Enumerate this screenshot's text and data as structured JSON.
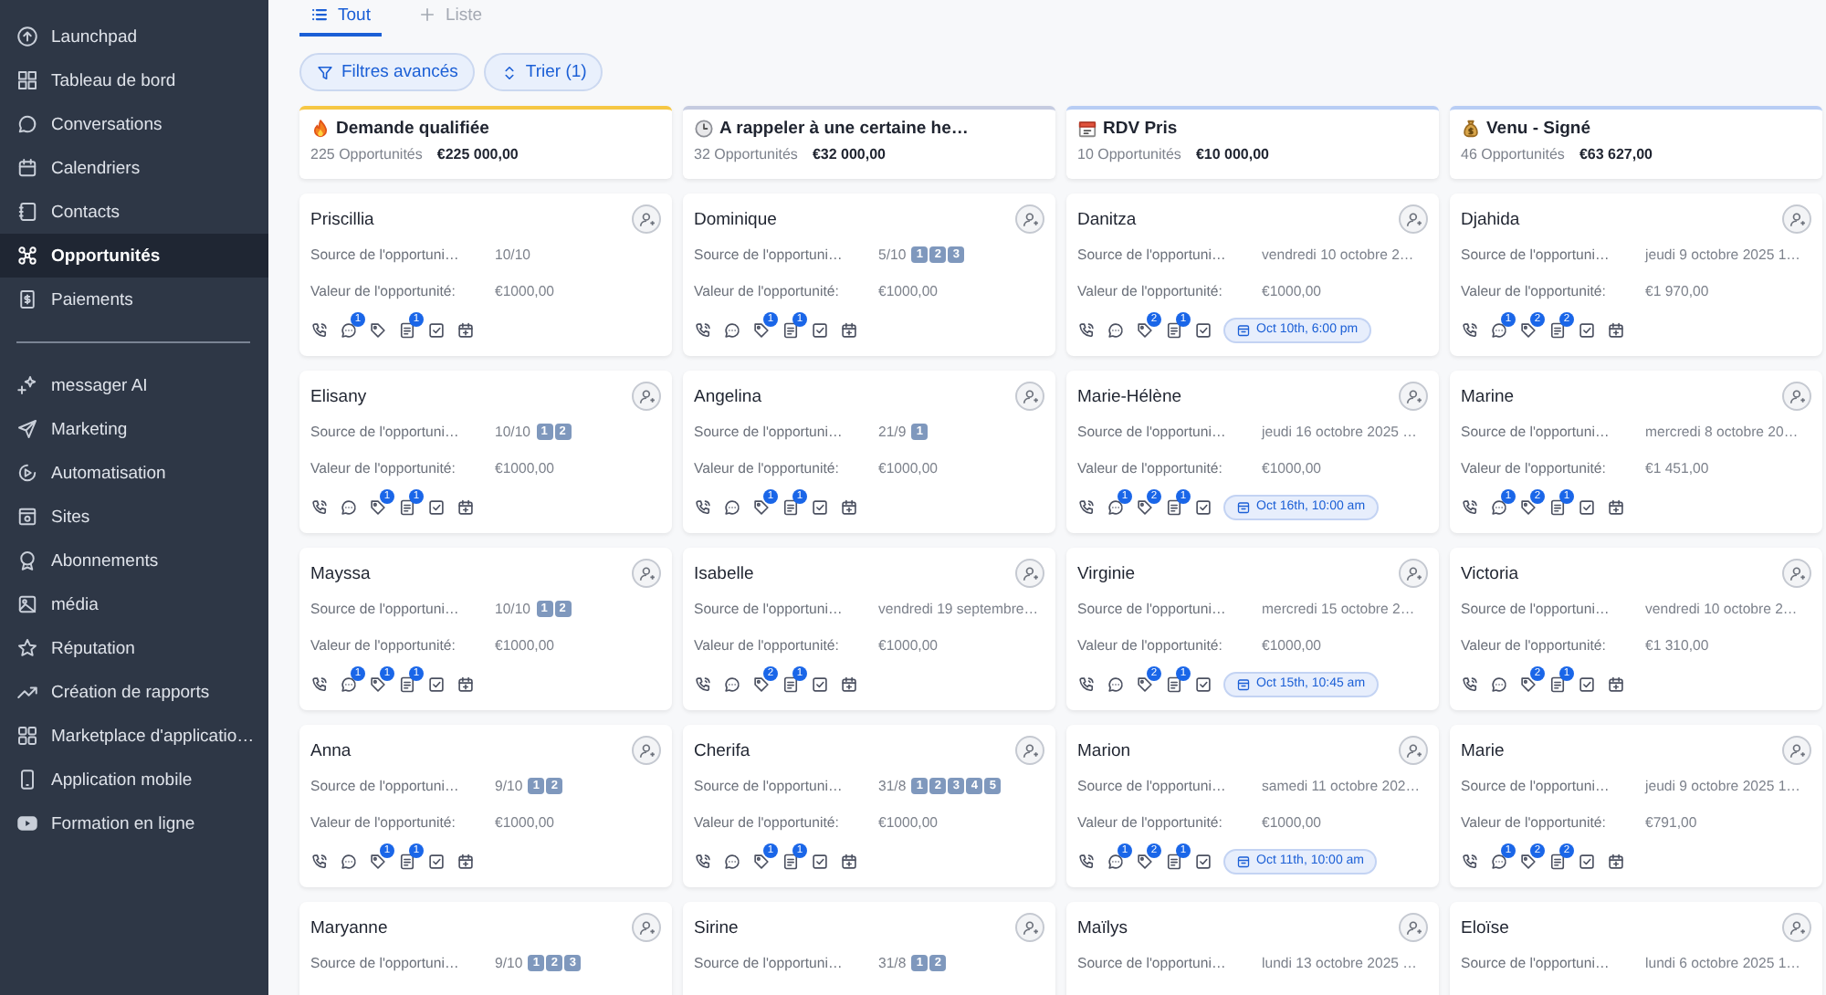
{
  "sidebar": {
    "sections": [
      {
        "items": [
          {
            "label": "Launchpad",
            "selected": false
          },
          {
            "label": "Tableau de bord",
            "selected": false
          },
          {
            "label": "Conversations",
            "selected": false
          },
          {
            "label": "Calendriers",
            "selected": false
          },
          {
            "label": "Contacts",
            "selected": false
          },
          {
            "label": "Opportunités",
            "selected": true
          },
          {
            "label": "Paiements",
            "selected": false
          }
        ]
      },
      {
        "items": [
          {
            "label": "messager AI",
            "selected": false
          },
          {
            "label": "Marketing",
            "selected": false
          },
          {
            "label": "Automatisation",
            "selected": false
          },
          {
            "label": "Sites",
            "selected": false
          },
          {
            "label": "Abonnements",
            "selected": false
          },
          {
            "label": "média",
            "selected": false
          },
          {
            "label": "Réputation",
            "selected": false
          },
          {
            "label": "Création de rapports",
            "selected": false
          },
          {
            "label": "Marketplace d'applicatio…",
            "selected": false
          },
          {
            "label": "Application mobile",
            "selected": false
          },
          {
            "label": "Formation en ligne",
            "selected": false
          }
        ]
      }
    ]
  },
  "tabs": [
    {
      "label": "Tout",
      "selected": true
    },
    {
      "label": "Liste",
      "selected": false
    }
  ],
  "filters": [
    "Filtres avancés",
    "Trier (1)"
  ],
  "columns": [
    {
      "title": "Demande qualifiée",
      "color": "#f6c744",
      "count": "225 Opportunités",
      "total": "€225 000,00",
      "cards": [
        {
          "name": "Priscillia",
          "fields": [
            {
              "label": "Source de l'opportuni…",
              "value": "10/10"
            },
            {
              "label": "Valeur de l'opportunité:",
              "value": "€1000,00"
            }
          ],
          "chat": "1",
          "note": "1"
        },
        {
          "name": "Elisany",
          "fields": [
            {
              "label": "Source de l'opportuni…",
              "value": "10/10",
              "keycaps": [
                "1",
                "2"
              ]
            },
            {
              "label": "Valeur de l'opportunité:",
              "value": "€1000,00"
            }
          ],
          "tag": "1",
          "note": "1"
        },
        {
          "name": "Mayssa",
          "fields": [
            {
              "label": "Source de l'opportuni…",
              "value": "10/10",
              "keycaps": [
                "1",
                "2"
              ]
            },
            {
              "label": "Valeur de l'opportunité:",
              "value": "€1000,00"
            }
          ],
          "chat": "1",
          "tag": "1",
          "note": "1"
        },
        {
          "name": "Anna",
          "fields": [
            {
              "label": "Source de l'opportuni…",
              "value": "9/10",
              "keycaps": [
                "1",
                "2"
              ]
            },
            {
              "label": "Valeur de l'opportunité:",
              "value": "€1000,00"
            }
          ],
          "tag": "1",
          "note": "1"
        },
        {
          "name": "Maryanne",
          "fields": [
            {
              "label": "Source de l'opportuni…",
              "value": "9/10",
              "keycaps": [
                "1",
                "2",
                "3"
              ]
            }
          ]
        }
      ]
    },
    {
      "title": "A rappeler à une certaine he…",
      "color": "#c5cbe0",
      "count": "32 Opportunités",
      "total": "€32 000,00",
      "cards": [
        {
          "name": "Dominique",
          "fields": [
            {
              "label": "Source de l'opportuni…",
              "value": "5/10",
              "keycaps": [
                "1",
                "2",
                "3"
              ]
            },
            {
              "label": "Valeur de l'opportunité:",
              "value": "€1000,00"
            }
          ],
          "tag": "1",
          "note": "1"
        },
        {
          "name": "Angelina",
          "fields": [
            {
              "label": "Source de l'opportuni…",
              "value": "21/9",
              "keycaps": [
                "1"
              ]
            },
            {
              "label": "Valeur de l'opportunité:",
              "value": "€1000,00"
            }
          ],
          "tag": "1",
          "note": "1"
        },
        {
          "name": "Isabelle",
          "fields": [
            {
              "label": "Source de l'opportuni…",
              "value": "vendredi 19 septembre…"
            },
            {
              "label": "Valeur de l'opportunité:",
              "value": "€1000,00"
            }
          ],
          "tag": "2",
          "note": "1"
        },
        {
          "name": "Cherifa",
          "fields": [
            {
              "label": "Source de l'opportuni…",
              "value": "31/8",
              "keycaps": [
                "1",
                "2",
                "3",
                "4",
                "5"
              ]
            },
            {
              "label": "Valeur de l'opportunité:",
              "value": "€1000,00"
            }
          ],
          "tag": "1",
          "note": "1"
        },
        {
          "name": "Sirine",
          "fields": [
            {
              "label": "Source de l'opportuni…",
              "value": "31/8",
              "keycaps": [
                "1",
                "2"
              ]
            }
          ]
        }
      ]
    },
    {
      "title": "RDV Pris",
      "color": "#b8cdf4",
      "count": "10 Opportunités",
      "total": "€10 000,00",
      "cards": [
        {
          "name": "Danitza",
          "fields": [
            {
              "label": "Source de l'opportuni…",
              "value": "vendredi 10 octobre 2…"
            },
            {
              "label": "Valeur de l'opportunité:",
              "value": "€1000,00"
            }
          ],
          "tag": "2",
          "note": "1",
          "appointment": "Oct 10th, 6:00 pm"
        },
        {
          "name": "Marie-Hélène",
          "fields": [
            {
              "label": "Source de l'opportuni…",
              "value": "jeudi 16 octobre 2025 …"
            },
            {
              "label": "Valeur de l'opportunité:",
              "value": "€1000,00"
            }
          ],
          "chat": "1",
          "tag": "2",
          "note": "1",
          "appointment": "Oct 16th, 10:00 am"
        },
        {
          "name": "Virginie",
          "fields": [
            {
              "label": "Source de l'opportuni…",
              "value": "mercredi 15 octobre 2…"
            },
            {
              "label": "Valeur de l'opportunité:",
              "value": "€1000,00"
            }
          ],
          "tag": "2",
          "note": "1",
          "appointment": "Oct 15th, 10:45 am"
        },
        {
          "name": "Marion",
          "fields": [
            {
              "label": "Source de l'opportuni…",
              "value": "samedi 11 octobre 202…"
            },
            {
              "label": "Valeur de l'opportunité:",
              "value": "€1000,00"
            }
          ],
          "chat": "1",
          "tag": "2",
          "note": "1",
          "appointment": "Oct 11th, 10:00 am"
        },
        {
          "name": "Maïlys",
          "fields": [
            {
              "label": "Source de l'opportuni…",
              "value": "lundi 13 octobre 2025 …"
            }
          ]
        }
      ]
    },
    {
      "title": "Venu - Signé",
      "color": "#b8cdf4",
      "count": "46 Opportunités",
      "total": "€63 627,00",
      "cards": [
        {
          "name": "Djahida",
          "fields": [
            {
              "label": "Source de l'opportuni…",
              "value": "jeudi 9 octobre 2025 1…"
            },
            {
              "label": "Valeur de l'opportunité:",
              "value": "€1 970,00"
            }
          ],
          "chat": "1",
          "tag": "2",
          "note": "2"
        },
        {
          "name": "Marine",
          "fields": [
            {
              "label": "Source de l'opportuni…",
              "value": "mercredi 8 octobre 20…"
            },
            {
              "label": "Valeur de l'opportunité:",
              "value": "€1 451,00"
            }
          ],
          "chat": "1",
          "tag": "2",
          "note": "1"
        },
        {
          "name": "Victoria",
          "fields": [
            {
              "label": "Source de l'opportuni…",
              "value": "vendredi 10 octobre 2…"
            },
            {
              "label": "Valeur de l'opportunité:",
              "value": "€1 310,00"
            }
          ],
          "tag": "2",
          "note": "1"
        },
        {
          "name": "Marie",
          "fields": [
            {
              "label": "Source de l'opportuni…",
              "value": "jeudi 9 octobre 2025 1…"
            },
            {
              "label": "Valeur de l'opportunité:",
              "value": "€791,00"
            }
          ],
          "chat": "1",
          "tag": "2",
          "note": "2"
        },
        {
          "name": "Eloïse",
          "fields": [
            {
              "label": "Source de l'opportuni…",
              "value": "lundi 6 octobre 2025 1…"
            }
          ]
        }
      ]
    }
  ]
}
